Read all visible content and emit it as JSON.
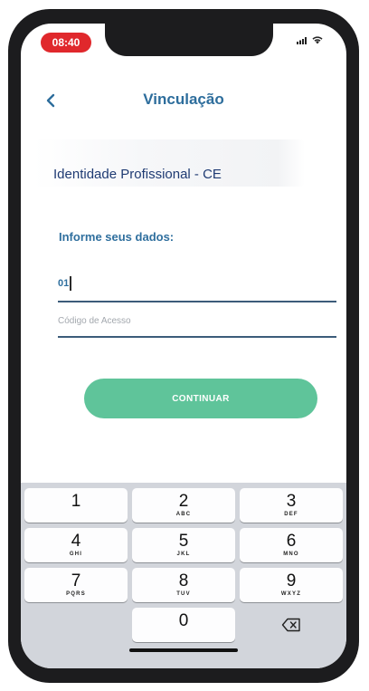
{
  "status_bar": {
    "time": "08:40"
  },
  "header": {
    "back_icon": "chevron-left-icon",
    "title": "Vinculação"
  },
  "profile": {
    "label": "Identidade Profissional - CE"
  },
  "form": {
    "section_label": "Informe seus dados:",
    "field1_value": "01",
    "field2_placeholder": "Código de Acesso",
    "submit_label": "CONTINUAR"
  },
  "keyboard": {
    "keys": [
      {
        "digit": "1",
        "letters": ""
      },
      {
        "digit": "2",
        "letters": "ABC"
      },
      {
        "digit": "3",
        "letters": "DEF"
      },
      {
        "digit": "4",
        "letters": "GHI"
      },
      {
        "digit": "5",
        "letters": "JKL"
      },
      {
        "digit": "6",
        "letters": "MNO"
      },
      {
        "digit": "7",
        "letters": "PQRS"
      },
      {
        "digit": "8",
        "letters": "TUV"
      },
      {
        "digit": "9",
        "letters": "WXYZ"
      },
      {
        "digit": "0",
        "letters": ""
      }
    ],
    "delete_icon": "backspace-icon"
  },
  "colors": {
    "accent": "#5fc49a",
    "title": "#2d6d9c",
    "time_pill": "#e0282c"
  }
}
